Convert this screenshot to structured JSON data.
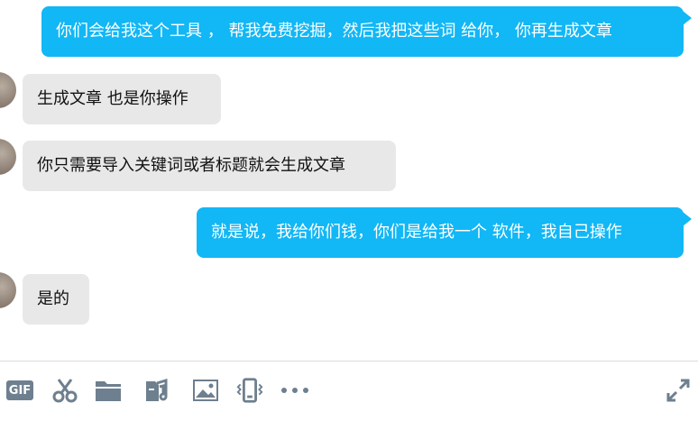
{
  "messages": [
    {
      "side": "out",
      "text": "你们会给我这个工具 ， 帮我免费挖掘，然后我把这些词 给你， 你再生成文章"
    },
    {
      "side": "in",
      "text": "生成文章 也是你操作"
    },
    {
      "side": "in",
      "text": "你只需要导入关键词或者标题就会生成文章"
    },
    {
      "side": "out",
      "text": "就是说，我给你们钱，你们是给我一个 软件，我自己操作"
    },
    {
      "side": "in",
      "text": "是的"
    }
  ],
  "toolbar": {
    "gif_label": "GIF",
    "items": [
      "gif-icon",
      "scissors-icon",
      "folder-icon",
      "music-file-icon",
      "image-icon",
      "shake-icon",
      "more-icon",
      "expand-icon"
    ],
    "icon_color": "#6e7f8f"
  },
  "colors": {
    "out_bubble": "#12b7f5",
    "in_bubble": "#e8e8e8"
  }
}
